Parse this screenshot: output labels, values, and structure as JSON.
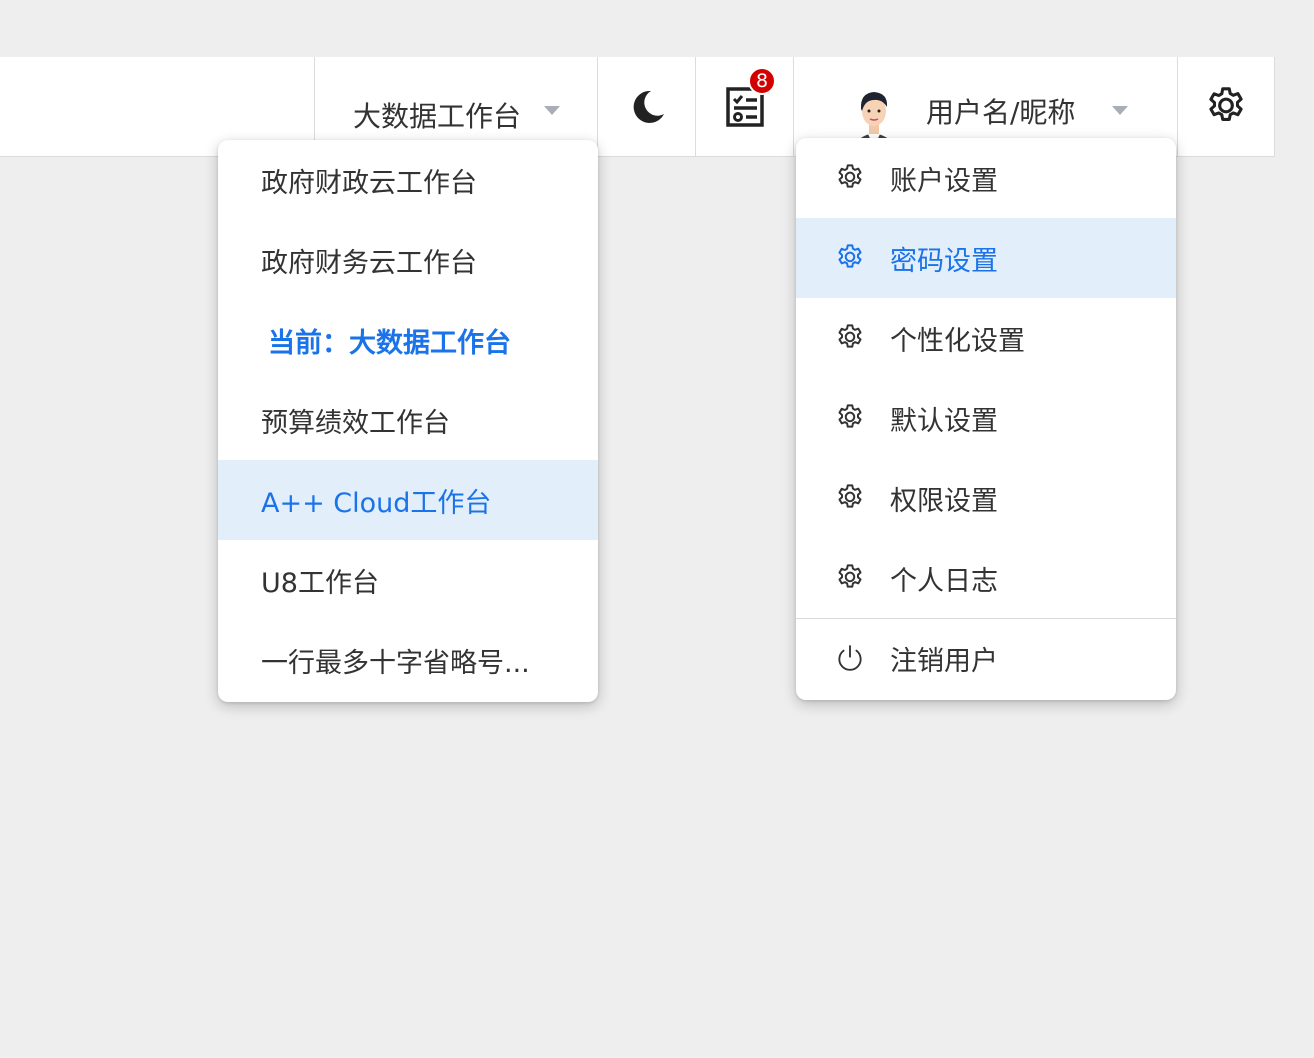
{
  "header": {
    "workspace_switch_label": "大数据工作台",
    "task_badge_count": "8",
    "username": "用户名/昵称"
  },
  "workspace_menu": {
    "items": [
      {
        "label": "政府财政云工作台",
        "state": "normal"
      },
      {
        "label": "政府财务云工作台",
        "state": "normal"
      },
      {
        "label": "当前：大数据工作台",
        "state": "current"
      },
      {
        "label": "预算绩效工作台",
        "state": "normal"
      },
      {
        "label": "A++ Cloud工作台",
        "state": "hover"
      },
      {
        "label": "U8工作台",
        "state": "normal"
      },
      {
        "label": "一行最多十字省略号...",
        "state": "normal"
      }
    ]
  },
  "user_menu": {
    "items": [
      {
        "label": "账户设置",
        "icon": "gear-icon",
        "state": "normal"
      },
      {
        "label": "密码设置",
        "icon": "gear-icon",
        "state": "hover"
      },
      {
        "label": "个性化设置",
        "icon": "gear-icon",
        "state": "normal"
      },
      {
        "label": "默认设置",
        "icon": "gear-icon",
        "state": "normal"
      },
      {
        "label": "权限设置",
        "icon": "gear-icon",
        "state": "normal"
      },
      {
        "label": "个人日志",
        "icon": "gear-icon",
        "state": "normal"
      }
    ],
    "logout_label": "注销用户",
    "logout_icon": "power-icon"
  },
  "colors": {
    "accent": "#1a73e8",
    "hover_bg": "#e3eefb",
    "badge": "#d40000",
    "page_bg": "#eeeeee"
  }
}
